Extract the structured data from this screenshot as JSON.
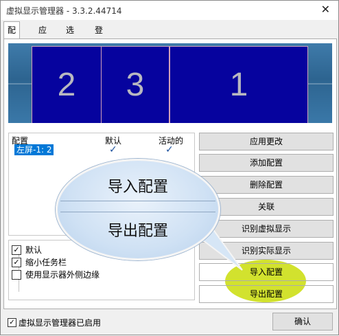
{
  "window": {
    "title": "虚拟显示管理器 - 3.3.2.44714",
    "close_glyph": "✕"
  },
  "tabs": [
    {
      "label": "配置"
    },
    {
      "label": "应用"
    },
    {
      "label": "选项"
    },
    {
      "label": "登录"
    }
  ],
  "preview": {
    "monitors": [
      {
        "label": "2"
      },
      {
        "label": "3"
      },
      {
        "label": "1"
      }
    ]
  },
  "config_list": {
    "headers": {
      "config": "配置",
      "default": "默认",
      "active": "活动的"
    },
    "rows": [
      {
        "name": "左屏-1: 2",
        "default_mark": "✓",
        "active_mark": "✓"
      }
    ]
  },
  "options": [
    {
      "label": "默认",
      "checked": true,
      "mark": "✓"
    },
    {
      "label": "缩小任务栏",
      "checked": true,
      "mark": "✓"
    },
    {
      "label": "使用显示器外侧边缘",
      "checked": false,
      "mark": ""
    }
  ],
  "buttons": {
    "apply": "应用更改",
    "add": "添加配置",
    "delete": "删除配置",
    "associate": "关联",
    "identify_virtual": "识别虚拟显示",
    "identify_real": "识别实际显示",
    "import": "导入配置",
    "export": "导出配置"
  },
  "magnifier": {
    "line1": "导入配置",
    "line2": "导出配置"
  },
  "footer": {
    "enabled_label": "虚拟显示管理器已启用",
    "enabled_mark": "✓",
    "ok_label": "确认"
  },
  "colors": {
    "monitor_fill": "#06039e",
    "highlight": "#c8dc00",
    "selection": "#0078d7"
  }
}
